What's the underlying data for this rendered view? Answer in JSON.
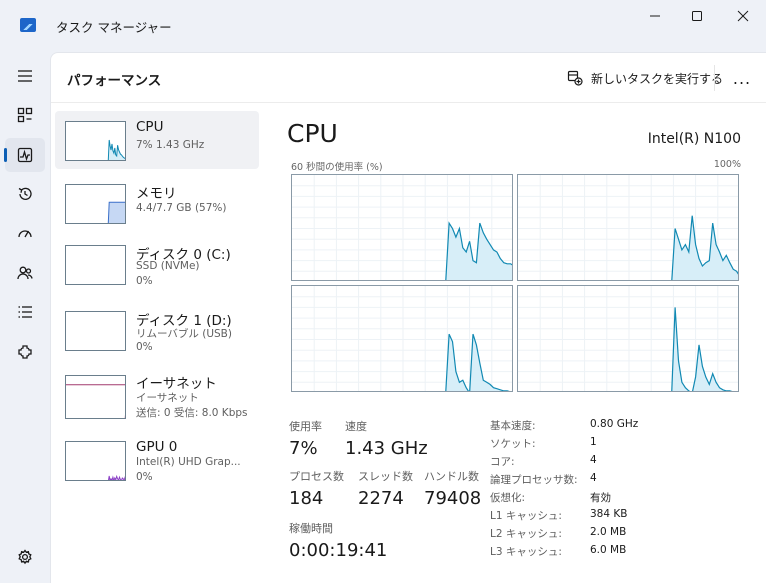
{
  "window": {
    "title": "タスク マネージャー"
  },
  "header": {
    "page_title": "パフォーマンス",
    "new_task_label": "新しいタスクを実行する",
    "more_label": "..."
  },
  "colors": {
    "cpu": "#1189b3",
    "cpu_fill": "#d7eef8",
    "memory": "#3a6fc9",
    "memory_fill": "#c6d8f4",
    "ethernet": "#a23a6e",
    "gpu": "#8b3fc6",
    "accent": "#0d5fb5"
  },
  "sidebar_icons": [
    "hamburger-icon",
    "processes-icon",
    "performance-icon",
    "app-history-icon",
    "startup-icon",
    "users-icon",
    "details-icon",
    "services-icon",
    "settings-icon"
  ],
  "resources": [
    {
      "name": "CPU",
      "sub1": "7%  1.43 GHz",
      "sub2": "",
      "sub3": ""
    },
    {
      "name": "メモリ",
      "sub1": "4.4/7.7 GB (57%)",
      "sub2": "",
      "sub3": ""
    },
    {
      "name": "ディスク 0 (C:)",
      "sub1": "SSD (NVMe)",
      "sub2": "0%",
      "sub3": ""
    },
    {
      "name": "ディスク 1 (D:)",
      "sub1": "リムーバブル (USB)",
      "sub2": "0%",
      "sub3": ""
    },
    {
      "name": "イーサネット",
      "sub1": "イーサネット",
      "sub2": "送信: 0  受信: 8.0 Kbps",
      "sub3": ""
    },
    {
      "name": "GPU 0",
      "sub1": "Intel(R) UHD Grap...",
      "sub2": "0%",
      "sub3": ""
    }
  ],
  "detail": {
    "title": "CPU",
    "model": "Intel(R) N100",
    "graph_label": "60 秒間の使用率 (%)",
    "graph_max": "100%",
    "stats": {
      "usage_label": "使用率",
      "usage_value": "7%",
      "speed_label": "速度",
      "speed_value": "1.43 GHz",
      "processes_label": "プロセス数",
      "processes_value": "184",
      "threads_label": "スレッド数",
      "threads_value": "2274",
      "handles_label": "ハンドル数",
      "handles_value": "79408",
      "uptime_label": "稼働時間",
      "uptime_value": "0:00:19:41"
    },
    "specs": [
      {
        "key": "基本速度:",
        "value": "0.80 GHz"
      },
      {
        "key": "ソケット:",
        "value": "1"
      },
      {
        "key": "コア:",
        "value": "4"
      },
      {
        "key": "論理プロセッサ数:",
        "value": "4"
      },
      {
        "key": "仮想化:",
        "value": "有効"
      },
      {
        "key": "L1 キャッシュ:",
        "value": "384 KB"
      },
      {
        "key": "L2 キャッシュ:",
        "value": "2.0 MB"
      },
      {
        "key": "L3 キャッシュ:",
        "value": "6.0 MB"
      }
    ]
  },
  "core_graphs": [
    {
      "core": 0,
      "usage": [
        0,
        0,
        0,
        0,
        0,
        0,
        0,
        0,
        0,
        0,
        0,
        0,
        0,
        0,
        0,
        0,
        0,
        0,
        0,
        0,
        0,
        0,
        0,
        0,
        0,
        0,
        0,
        0,
        0,
        0,
        0,
        0,
        0,
        0,
        0,
        0,
        0,
        0,
        0,
        0,
        0,
        0,
        0,
        0,
        0,
        0,
        55,
        50,
        42,
        50,
        32,
        28,
        38,
        20,
        18,
        55,
        46,
        40,
        35,
        30,
        28,
        22,
        18,
        17,
        17,
        15
      ]
    },
    {
      "core": 1,
      "usage": [
        0,
        0,
        0,
        0,
        0,
        0,
        0,
        0,
        0,
        0,
        0,
        0,
        0,
        0,
        0,
        0,
        0,
        0,
        0,
        0,
        0,
        0,
        0,
        0,
        0,
        0,
        0,
        0,
        0,
        0,
        0,
        0,
        0,
        0,
        0,
        0,
        0,
        0,
        0,
        0,
        0,
        0,
        0,
        0,
        0,
        0,
        50,
        40,
        30,
        35,
        28,
        62,
        35,
        22,
        15,
        18,
        20,
        55,
        35,
        28,
        20,
        25,
        18,
        12,
        10,
        5
      ]
    },
    {
      "core": 2,
      "usage": [
        0,
        0,
        0,
        0,
        0,
        0,
        0,
        0,
        0,
        0,
        0,
        0,
        0,
        0,
        0,
        0,
        0,
        0,
        0,
        0,
        0,
        0,
        0,
        0,
        0,
        0,
        0,
        0,
        0,
        0,
        0,
        0,
        0,
        0,
        0,
        0,
        0,
        0,
        0,
        0,
        0,
        0,
        0,
        0,
        0,
        0,
        55,
        48,
        20,
        10,
        12,
        5,
        0,
        55,
        45,
        28,
        12,
        10,
        8,
        5,
        4,
        3,
        2,
        2,
        1,
        1
      ]
    },
    {
      "core": 3,
      "usage": [
        0,
        0,
        0,
        0,
        0,
        0,
        0,
        0,
        0,
        0,
        0,
        0,
        0,
        0,
        0,
        0,
        0,
        0,
        0,
        0,
        0,
        0,
        0,
        0,
        0,
        0,
        0,
        0,
        0,
        0,
        0,
        0,
        0,
        0,
        0,
        0,
        0,
        0,
        0,
        0,
        0,
        0,
        0,
        0,
        0,
        0,
        80,
        30,
        10,
        5,
        2,
        0,
        15,
        45,
        25,
        15,
        8,
        18,
        10,
        5,
        3,
        2,
        2,
        1,
        1,
        1
      ]
    }
  ],
  "thumbnails": {
    "cpu": [
      0,
      0,
      0,
      0,
      0,
      0,
      0,
      0,
      0,
      0,
      0,
      0,
      0,
      0,
      0,
      0,
      0,
      0,
      0,
      0,
      0,
      0,
      0,
      0,
      0,
      0,
      0,
      0,
      0,
      0,
      0,
      0,
      0,
      0,
      0,
      0,
      0,
      0,
      0,
      0,
      0,
      0,
      0,
      0,
      0,
      0,
      55,
      40,
      30,
      45,
      28,
      22,
      35,
      18,
      15,
      42,
      30,
      25,
      20,
      18,
      15,
      12,
      10,
      9,
      8,
      8
    ],
    "memory": [
      0,
      0,
      0,
      0,
      0,
      0,
      0,
      0,
      0,
      0,
      0,
      0,
      0,
      0,
      0,
      0,
      0,
      0,
      0,
      0,
      0,
      0,
      0,
      0,
      0,
      0,
      0,
      0,
      0,
      0,
      0,
      0,
      0,
      0,
      0,
      0,
      0,
      0,
      0,
      0,
      0,
      0,
      0,
      0,
      0,
      0,
      57,
      57,
      57,
      57,
      57,
      57,
      57,
      57,
      57,
      57,
      57,
      57,
      57,
      57,
      57,
      57,
      57,
      57,
      57,
      57
    ],
    "disk0": [
      0,
      0,
      0,
      0,
      0,
      0,
      0,
      0,
      0,
      0,
      0,
      0,
      0,
      0,
      0,
      0,
      0,
      0,
      0,
      0,
      0,
      0,
      0,
      0,
      0,
      0,
      0,
      0,
      0,
      0,
      0,
      0,
      0,
      0,
      0,
      0,
      0,
      0,
      0,
      0,
      0,
      0,
      0,
      0,
      0,
      0,
      0,
      0,
      2,
      0,
      0,
      0,
      1,
      0,
      0,
      0,
      0,
      0,
      0,
      0,
      0,
      0,
      0,
      0,
      0,
      0
    ],
    "disk1": [
      0,
      0,
      0,
      0,
      0,
      0,
      0,
      0,
      0,
      0,
      0,
      0,
      0,
      0,
      0,
      0,
      0,
      0,
      0,
      0,
      0,
      0,
      0,
      0,
      0,
      0,
      0,
      0,
      0,
      0,
      0,
      0,
      0,
      0,
      0,
      0,
      0,
      0,
      0,
      0,
      0,
      0,
      0,
      0,
      0,
      0,
      0,
      0,
      0,
      0,
      0,
      0,
      0,
      0,
      0,
      0,
      0,
      0,
      0,
      0,
      0,
      0,
      0,
      0,
      0,
      0
    ],
    "ethernet": [
      0,
      0,
      0,
      0,
      0,
      0,
      0,
      0,
      0,
      0,
      0,
      0,
      0,
      0,
      0,
      0,
      0,
      0,
      0,
      0,
      0,
      0,
      0,
      0,
      0,
      0,
      0,
      0,
      0,
      0,
      0,
      0,
      0,
      0,
      0,
      0,
      0,
      0,
      0,
      0,
      0,
      0,
      0,
      0,
      0,
      0,
      0,
      0,
      0,
      0,
      0,
      0,
      0,
      0,
      0,
      0,
      0,
      0,
      0,
      0,
      0,
      0,
      0,
      0,
      30,
      15
    ],
    "gpu": [
      0,
      0,
      0,
      0,
      0,
      0,
      0,
      0,
      0,
      0,
      0,
      0,
      0,
      0,
      0,
      0,
      0,
      0,
      0,
      0,
      0,
      0,
      0,
      0,
      0,
      0,
      0,
      0,
      0,
      0,
      0,
      0,
      0,
      0,
      0,
      0,
      0,
      0,
      0,
      0,
      0,
      0,
      0,
      0,
      0,
      0,
      15,
      2,
      8,
      4,
      12,
      3,
      10,
      6,
      14,
      8,
      5,
      12,
      6,
      3,
      10,
      8,
      5,
      12,
      8,
      6
    ]
  }
}
